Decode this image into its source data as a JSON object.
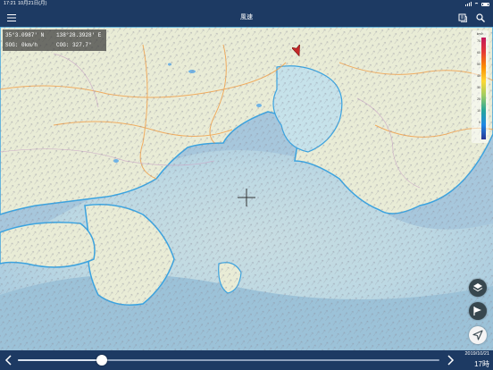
{
  "status_bar": {
    "time": "17:21",
    "date": "10月21日(月)"
  },
  "nav": {
    "title": "風速"
  },
  "info": {
    "latitude": "35°3.0987' N",
    "longitude": "138°28.3928' E",
    "sog": "SOG: 0km/h",
    "cog": "COG: 327.7°"
  },
  "legend": {
    "unit": "km/h",
    "ticks": [
      "70",
      "60",
      "50",
      "40",
      "30",
      "20",
      "10",
      "5",
      ""
    ]
  },
  "timeline": {
    "date": "2019/10/21",
    "hour": "17時",
    "progress": 0.2
  },
  "colors": {
    "bar": "#1d3a63",
    "sea_shallow": "#cfe7e9",
    "sea_deep": "#9fc0d6",
    "land": "#e9ecd6",
    "coast": "#3aa3e0",
    "roads": "#f2a14b",
    "boat_marker": "#c62828"
  },
  "icons": [
    "menu-icon",
    "layers-book-icon",
    "search-icon",
    "crosshair-icon",
    "layers-stack-icon",
    "route-flag-icon",
    "navigation-arrow-icon",
    "chevron-left-icon",
    "chevron-right-icon"
  ]
}
